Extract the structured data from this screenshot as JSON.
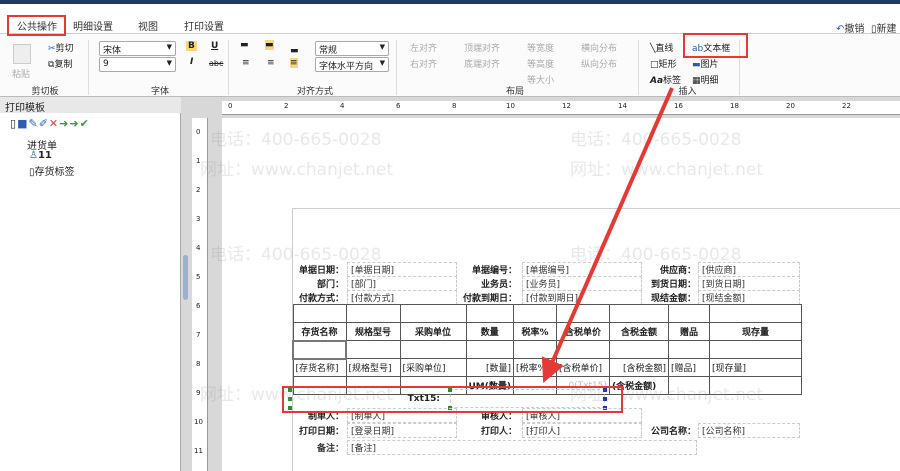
{
  "tabs": [
    {
      "label": "公共操作"
    },
    {
      "label": "明细设置"
    },
    {
      "label": "视图"
    },
    {
      "label": "打印设置"
    }
  ],
  "quick": {
    "undo": "撤销",
    "new": "新建"
  },
  "ribbon": {
    "clipboard": {
      "label": "剪切板",
      "paste": "粘贴",
      "cut": "剪切",
      "copy": "复制"
    },
    "font": {
      "label": "字体",
      "family": "宋体",
      "size": "9",
      "bold": "B",
      "italic": "I",
      "underline": "U",
      "strike": "abc"
    },
    "align": {
      "label": "对齐方式",
      "style": "常规",
      "direction": "字体水平方向"
    },
    "layout": {
      "label": "布局",
      "items": [
        "左对齐",
        "右对齐",
        "顶端对齐",
        "底端对齐",
        "等宽度",
        "等高度",
        "等大小",
        "横向分布",
        "纵向分布"
      ]
    },
    "insert": {
      "label": "插入",
      "line": "直线",
      "textbox": "文本框",
      "rect": "矩形",
      "image": "图片",
      "label_item": "标签",
      "detail": "明细"
    }
  },
  "left": {
    "title": "打印模板",
    "tree": {
      "root": "进货单",
      "items": [
        "11",
        "存货标签"
      ]
    }
  },
  "ruler": {
    "top": [
      "0",
      "2",
      "4",
      "6",
      "8",
      "10",
      "12",
      "14",
      "16",
      "18",
      "20",
      "22"
    ],
    "left": [
      "0",
      "1",
      "2",
      "3",
      "4",
      "5",
      "6",
      "7",
      "8",
      "9",
      "10",
      "11"
    ]
  },
  "doc": {
    "header": [
      [
        "单据日期：",
        "[单据日期]",
        "单据编号：",
        "[单据编号]",
        "供应商：",
        "[供应商]"
      ],
      [
        "部门：",
        "[部门]",
        "业务员：",
        "[业务员]",
        "到货日期：",
        "[到货日期]"
      ],
      [
        "付款方式：",
        "[付款方式]",
        "付款到期日：",
        "[付款到期日]",
        "现结金额：",
        "[现结金额]"
      ]
    ],
    "columns": [
      "存货名称",
      "规格型号",
      "采购单位",
      "数量",
      "税率%",
      "含税单价",
      "含税金额",
      "赠品",
      "现存量"
    ],
    "fields": [
      "[存货名称]",
      "[规格型号]",
      "[采购单位]",
      "[数量]",
      "[税率%]",
      "[含税单价]",
      "[含税金额]",
      "[赠品]",
      "[现存量]"
    ],
    "sums": [
      "",
      "",
      "",
      "UM(数量)",
      "",
      "0(Txt15)",
      "(含税金额)",
      "",
      ""
    ],
    "txt15": "Txt15:",
    "footer": [
      [
        "制单人：",
        "[制单人]",
        "审核人：",
        "[审核人]",
        "",
        ""
      ],
      [
        "打印日期：",
        "[登录日期]",
        "打印人：",
        "[打印人]",
        "公司名称：",
        "[公司名称]"
      ]
    ],
    "remark": [
      "备注：",
      "[备注]"
    ]
  },
  "watermark": {
    "phone": "电话：400-665-0028",
    "site": "网址：www.chanjet.net"
  },
  "colors": {
    "accent": "#e53935"
  }
}
